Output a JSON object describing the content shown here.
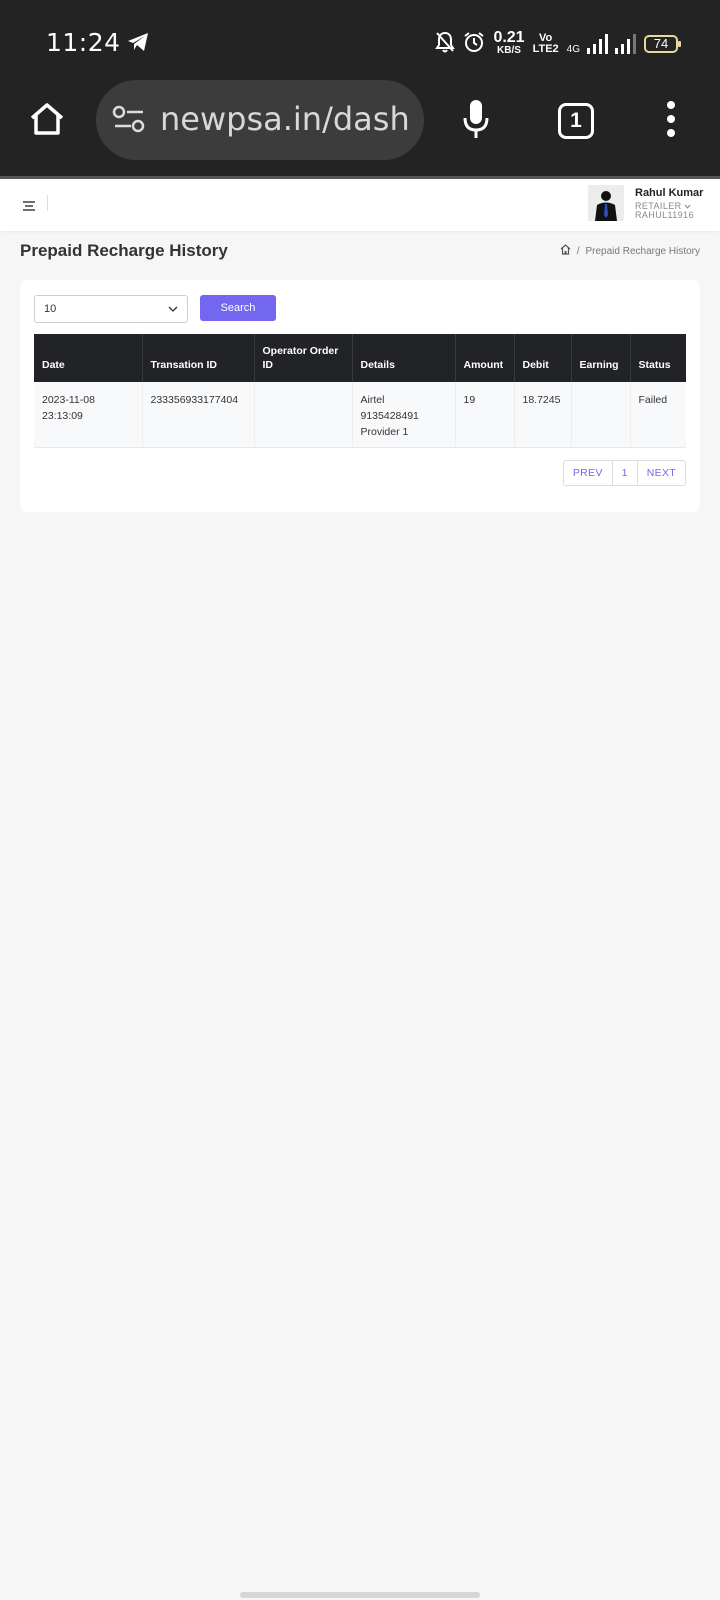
{
  "status_bar": {
    "time": "11:24",
    "net_speed_value": "0.21",
    "net_speed_unit": "KB/S",
    "volte_top": "Vo",
    "volte_bottom": "LTE2",
    "network_type": "4G",
    "battery": "74",
    "icons": [
      "telegram-icon",
      "mute-bell-icon",
      "alarm-icon",
      "signal-icon",
      "battery-icon"
    ]
  },
  "browser": {
    "url": "newpsa.in/dashboard",
    "tab_count": "1",
    "icons": [
      "home-icon",
      "site-settings-icon",
      "mic-icon",
      "tabs-icon",
      "more-vert-icon"
    ]
  },
  "header": {
    "user_name": "Rahul Kumar",
    "user_role": "RETAILER",
    "user_id": "RAHUL11916",
    "icons": [
      "hamburger-icon",
      "avatar",
      "chevron-down-icon"
    ]
  },
  "page": {
    "title": "Prepaid Recharge History",
    "breadcrumb_sep": "/",
    "breadcrumb_current": "Prepaid Recharge History"
  },
  "filters": {
    "page_size": "10",
    "search_label": "Search"
  },
  "table": {
    "columns": [
      "Date",
      "Transation ID",
      "Operator Order ID",
      "Details",
      "Amount",
      "Debit",
      "Earning",
      "Status"
    ],
    "rows": [
      {
        "date_line1": "2023-11-08",
        "date_line2": "23:13:09",
        "transaction_id": "233356933177404",
        "operator_order_id": "",
        "details_line1": "Airtel",
        "details_line2": "9135428491",
        "details_line3": "Provider 1",
        "amount": "19",
        "debit": "18.7245",
        "earning": "",
        "status": "Failed"
      }
    ]
  },
  "pagination": {
    "prev": "PREV",
    "page": "1",
    "next": "NEXT"
  },
  "colors": {
    "accent": "#7367f0",
    "table_header": "#222326",
    "chrome": "#232323"
  }
}
